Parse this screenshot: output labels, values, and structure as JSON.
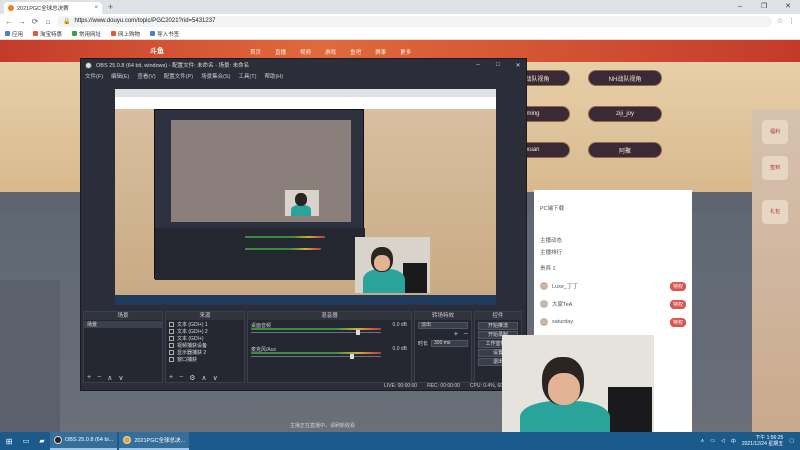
{
  "browser": {
    "tab_title": "2021PGC全球总决赛",
    "tab_close": "×",
    "new_tab": "+",
    "window_controls": [
      "–",
      "❐",
      "✕"
    ],
    "url": "https://www.douyu.com/topic/PGC2021?rid=5431237",
    "back": "←",
    "forward": "→",
    "reload": "⟳",
    "home": "⌂",
    "star": "☆",
    "menu": "⋮",
    "bookmarks": [
      {
        "label": "应用",
        "color": "#4a7fd6"
      },
      {
        "label": "淘宝特惠",
        "color": "#e35b2e"
      },
      {
        "label": "常用网址",
        "color": "#3b9e4a"
      },
      {
        "label": "网上购物",
        "color": "#e35b2e"
      },
      {
        "label": "导入书签",
        "color": "#4a7fd6"
      }
    ]
  },
  "douyu": {
    "logo": "斗鱼",
    "menu": [
      "首页",
      "直播",
      "视频",
      "游戏",
      "鱼吧",
      "赛事",
      "更多"
    ],
    "team_buttons": [
      "NH战队视角",
      "NH战队视角",
      "ming",
      "ziji_joy",
      "xuan",
      "阿聚"
    ],
    "right_panel": {
      "row1": "PC端下载",
      "row2": "主播动态",
      "row3": "主播排行",
      "row4": "贵宾 1",
      "users": [
        "Luxe_丁丁",
        "大家TeA",
        "saturday"
      ],
      "badges": [
        "特权",
        "特权",
        "特权"
      ]
    },
    "rail": [
      "福利",
      "签到",
      "礼包"
    ],
    "bottom_text": "主播正在直播中，请刷新收看"
  },
  "obs": {
    "title": "OBS 25.0.8 (64 bit, windows) - 配置文件: 未命名 - 场景: 未命名",
    "window_controls": [
      "–",
      "□",
      "✕"
    ],
    "menu": [
      "文件(F)",
      "编辑(E)",
      "查看(V)",
      "配置文件(P)",
      "场景集合(S)",
      "工具(T)",
      "帮助(H)"
    ],
    "docks": {
      "scenes": {
        "title": "场景",
        "items": [
          "场景"
        ]
      },
      "sources": {
        "title": "来源",
        "items": [
          "文本 (GDI+) 1",
          "文本 (GDI+) 2",
          "文本 (GDI+)",
          "视频捕获设备",
          "显示器捕获 2",
          "窗口捕获"
        ]
      },
      "mixer": {
        "title": "混音器",
        "rows": [
          {
            "name": "桌面音频",
            "db": "0.0 dB",
            "level": 0.82
          },
          {
            "name": "麦克风/Aux",
            "db": "0.0 dB",
            "level": 0.78
          }
        ]
      },
      "transitions": {
        "title": "转场特效",
        "type": "淡出",
        "duration_label": "时长",
        "duration": "300 ms"
      },
      "controls": {
        "title": "控件",
        "buttons": [
          "开始推流",
          "开始录制",
          "工作室模式",
          "设置",
          "退出"
        ]
      }
    },
    "footer_icons": [
      "+",
      "−",
      "∧",
      "∨"
    ],
    "status": [
      "LIVE: 00:00:00",
      "REC: 00:00:00",
      "CPU: 0.4%, 60.00 fps"
    ]
  },
  "taskbar": {
    "start": "⊞",
    "apps": [
      "OBS 25.0.8 (64 bi...",
      "2021PGC全球总决..."
    ],
    "tray_ime": "中",
    "time": "下午 1:56:25",
    "date": "2021/12/24 星期五"
  },
  "colors": {
    "douyu_red": "#c43a2a",
    "obs_bg": "#2b2e38",
    "taskbar": "#1b5b8c"
  }
}
